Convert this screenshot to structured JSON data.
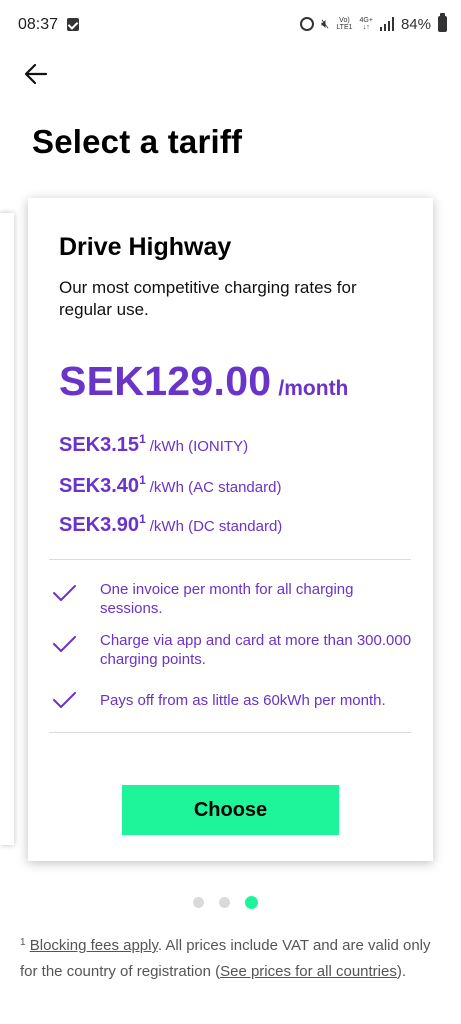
{
  "status": {
    "time": "08:37",
    "battery": "84%",
    "network_top": "Vo)",
    "network_bottom": "LTE1",
    "gen_top": "4G+",
    "gen_bottom": "↓↑"
  },
  "header": {
    "title": "Select a tariff"
  },
  "card": {
    "title": "Drive Highway",
    "description": "Our most competitive charging rates for regular use.",
    "price": "SEK129.00",
    "price_unit": "/month",
    "rates": [
      {
        "value": "SEK3.15",
        "sup": "1",
        "unit": "/kWh (IONITY)"
      },
      {
        "value": "SEK3.40",
        "sup": "1",
        "unit": "/kWh (AC standard)"
      },
      {
        "value": "SEK3.90",
        "sup": "1",
        "unit": "/kWh (DC standard)"
      }
    ],
    "features": [
      "One invoice per month for all charging sessions.",
      "Charge via app and card at more than 300.000 charging points.",
      "Pays off from as little as 60kWh per month."
    ],
    "choose_label": "Choose"
  },
  "pager": {
    "count": 3,
    "active_index": 2
  },
  "footnote": {
    "marker": "1",
    "link1": "Blocking fees apply",
    "text1": ". All prices include VAT and are valid only for the country of registration (",
    "link2": "See prices for all countries",
    "text2": ")."
  },
  "colors": {
    "accent_purple": "#6a33c9",
    "accent_green": "#1ef59b"
  }
}
